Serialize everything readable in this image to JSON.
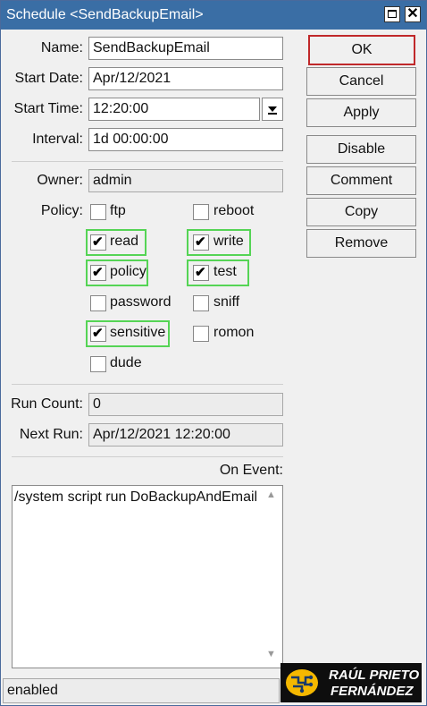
{
  "window": {
    "title": "Schedule <SendBackupEmail>"
  },
  "labels": {
    "name": "Name:",
    "start_date": "Start Date:",
    "start_time": "Start Time:",
    "interval": "Interval:",
    "owner": "Owner:",
    "policy": "Policy:",
    "run_count": "Run Count:",
    "next_run": "Next Run:",
    "on_event": "On Event:"
  },
  "fields": {
    "name": "SendBackupEmail",
    "start_date": "Apr/12/2021",
    "start_time": "12:20:00",
    "interval": "1d 00:00:00",
    "owner": "admin",
    "run_count": "0",
    "next_run": "Apr/12/2021 12:20:00",
    "on_event": "/system script run DoBackupAndEmail"
  },
  "buttons": {
    "ok": "OK",
    "cancel": "Cancel",
    "apply": "Apply",
    "disable": "Disable",
    "comment": "Comment",
    "copy": "Copy",
    "remove": "Remove"
  },
  "policies": [
    {
      "label": "ftp",
      "checked": false,
      "highlighted": false
    },
    {
      "label": "reboot",
      "checked": false,
      "highlighted": false
    },
    {
      "label": "read",
      "checked": true,
      "highlighted": true
    },
    {
      "label": "write",
      "checked": true,
      "highlighted": true
    },
    {
      "label": "policy",
      "checked": true,
      "highlighted": true
    },
    {
      "label": "test",
      "checked": true,
      "highlighted": true
    },
    {
      "label": "password",
      "checked": false,
      "highlighted": false
    },
    {
      "label": "sniff",
      "checked": false,
      "highlighted": false
    },
    {
      "label": "sensitive",
      "checked": true,
      "highlighted": true
    },
    {
      "label": "romon",
      "checked": false,
      "highlighted": false
    },
    {
      "label": "dude",
      "checked": false,
      "highlighted": false
    }
  ],
  "status": "enabled",
  "logo": {
    "line1": "RAÚL PRIETO",
    "line2": "FERNÁNDEZ"
  },
  "colors": {
    "titlebar": "#3a6ea5",
    "ok_border": "#c0282a",
    "highlight": "#55d455"
  }
}
